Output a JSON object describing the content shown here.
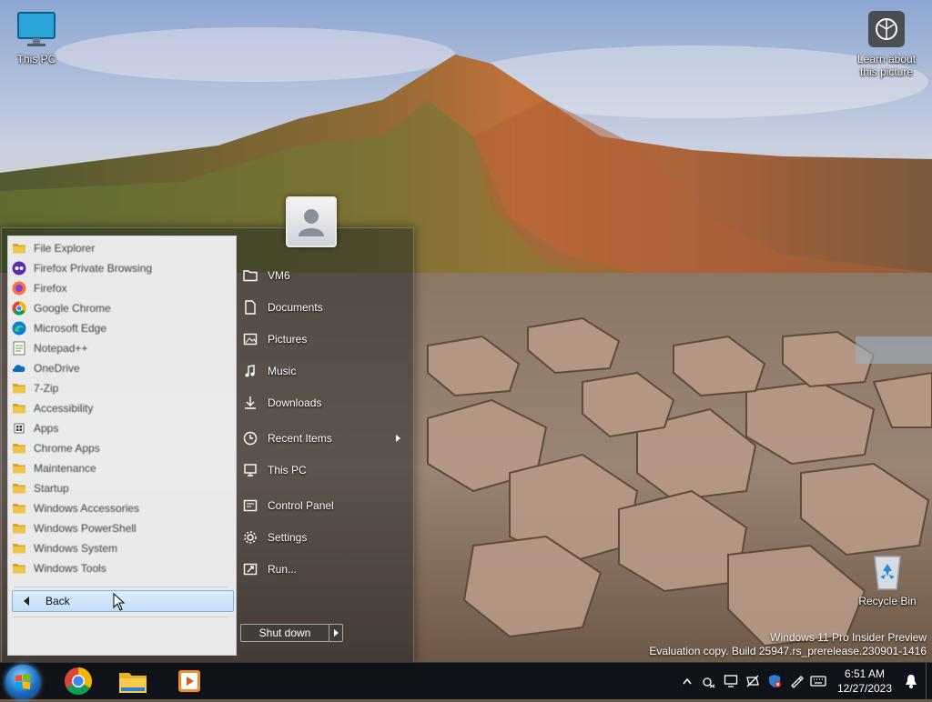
{
  "desktop": {
    "this_pc_label": "This PC",
    "learn_label_1": "Learn about",
    "learn_label_2": "this picture",
    "recycle_label": "Recycle Bin",
    "watermark_line1": "Windows 11 Pro Insider Preview",
    "watermark_line2": "Evaluation copy. Build 25947.rs_prerelease.230901-1416"
  },
  "start_menu": {
    "programs": [
      {
        "label": "File Explorer",
        "icon": "folder-icon"
      },
      {
        "label": "Firefox Private Browsing",
        "icon": "firefox-private-icon"
      },
      {
        "label": "Firefox",
        "icon": "firefox-icon"
      },
      {
        "label": "Google Chrome",
        "icon": "chrome-icon"
      },
      {
        "label": "Microsoft Edge",
        "icon": "edge-icon"
      },
      {
        "label": "Notepad++",
        "icon": "notepad-icon"
      },
      {
        "label": "OneDrive",
        "icon": "onedrive-icon"
      },
      {
        "label": "7-Zip",
        "icon": "folder-icon"
      },
      {
        "label": "Accessibility",
        "icon": "folder-icon"
      },
      {
        "label": "Apps",
        "icon": "apps-icon"
      },
      {
        "label": "Chrome Apps",
        "icon": "folder-icon"
      },
      {
        "label": "Maintenance",
        "icon": "folder-icon"
      },
      {
        "label": "Startup",
        "icon": "folder-icon"
      },
      {
        "label": "Windows Accessories",
        "icon": "folder-icon"
      },
      {
        "label": "Windows PowerShell",
        "icon": "folder-icon"
      },
      {
        "label": "Windows System",
        "icon": "folder-icon"
      },
      {
        "label": "Windows Tools",
        "icon": "folder-icon"
      }
    ],
    "back_label": "Back",
    "right_items": [
      {
        "label": "VM6",
        "icon": "folder-outline-icon"
      },
      {
        "label": "Documents",
        "icon": "document-icon"
      },
      {
        "label": "Pictures",
        "icon": "picture-icon"
      },
      {
        "label": "Music",
        "icon": "music-note-icon"
      },
      {
        "label": "Downloads",
        "icon": "download-icon"
      },
      {
        "label": "Recent Items",
        "icon": "clock-icon"
      },
      {
        "label": "This PC",
        "icon": "computer-icon"
      },
      {
        "label": "Control Panel",
        "icon": "control-panel-icon"
      },
      {
        "label": "Settings",
        "icon": "gear-icon"
      },
      {
        "label": "Run...",
        "icon": "run-icon"
      }
    ],
    "shutdown_label": "Shut down"
  },
  "taskbar": {
    "pinned": [
      "chrome-icon",
      "file-explorer-icon",
      "media-player-icon"
    ],
    "clock_time": "6:51 AM",
    "clock_date": "12/27/2023",
    "tray_icons": [
      "chevron-up-icon",
      "network-off-icon",
      "display-icon",
      "network-icon",
      "security-icon",
      "pen-icon",
      "keyboard-icon",
      "notification-bell-icon"
    ]
  },
  "colors": {
    "taskbar_bg": "#080c14",
    "back_button_bg": "#c2def8",
    "folder_yellow": "#e7b83b"
  }
}
